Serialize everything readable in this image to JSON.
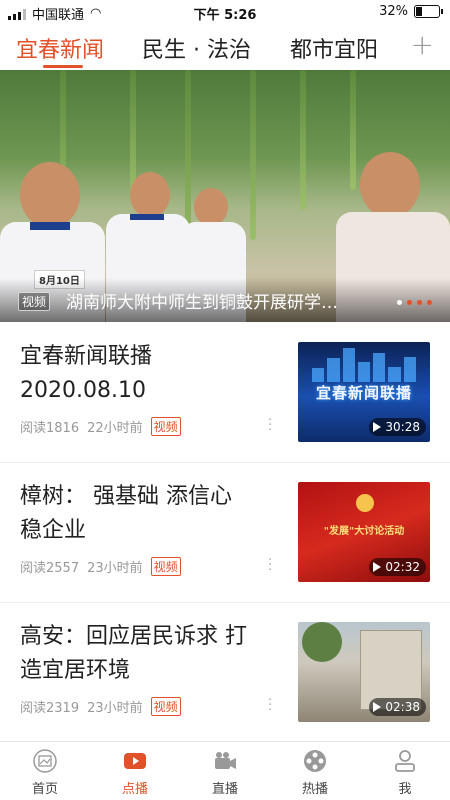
{
  "status": {
    "carrier": "中国联通",
    "time": "下午 5:26",
    "battery_percent": "32%",
    "battery_level": 0.32
  },
  "channels": {
    "tabs": [
      "宜春新闻",
      "民生 · 法治",
      "都市宜阳"
    ],
    "active_index": 0
  },
  "hero": {
    "date_tag": "8月10日",
    "tag": "视频",
    "title": "湖南师大附中师生到铜鼓开展研学…",
    "slides": 4,
    "active_slide": 0
  },
  "articles": [
    {
      "title": "宜春新闻联播\n2020.08.10",
      "reads": "阅读1816",
      "time": "22小时前",
      "tag": "视频",
      "duration": "30:28",
      "thumb_text": "宜春新闻联播"
    },
    {
      "title": "樟树： 强基础 添信心\n稳企业",
      "reads": "阅读2557",
      "time": "23小时前",
      "tag": "视频",
      "duration": "02:32",
      "thumb_text": "\"发展\"大讨论活动"
    },
    {
      "title": "高安：回应居民诉求 打\n造宜居环境",
      "reads": "阅读2319",
      "time": "23小时前",
      "tag": "视频",
      "duration": "02:38"
    }
  ],
  "tabbar": {
    "items": [
      "首页",
      "点播",
      "直播",
      "热播",
      "我"
    ],
    "active_index": 1
  },
  "colors": {
    "accent": "#e2522a"
  }
}
